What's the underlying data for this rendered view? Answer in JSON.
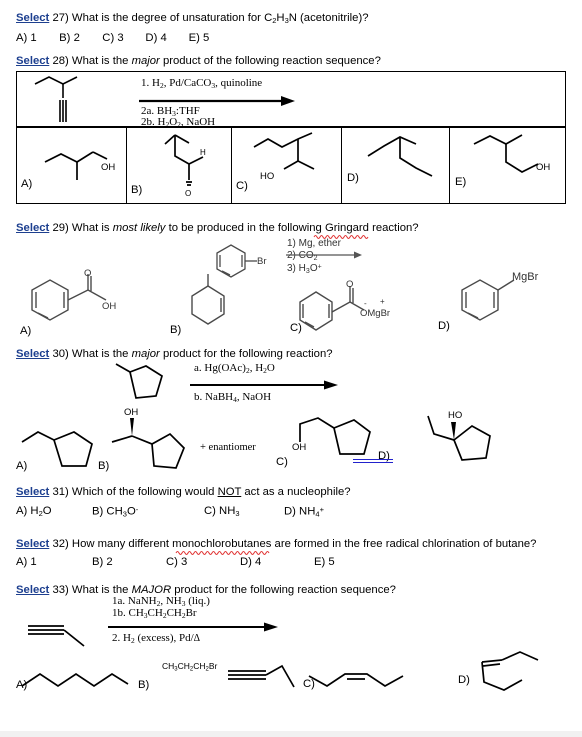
{
  "page": {
    "background": "#ffffff",
    "link_color": "#1d3f8f",
    "spellcheck_underline_color": "#e03030"
  },
  "questions": [
    {
      "id": "q27",
      "select_label": "Select",
      "number": "27)",
      "stem_pre": "What is the degree of unsaturation for C",
      "stem_formula": "C2H3N",
      "stem_post": " (acetonitrile)?",
      "options": [
        "A) 1",
        "B) 2",
        "C) 3",
        "D) 4",
        "E) 5"
      ]
    },
    {
      "id": "q28",
      "select_label": "Select",
      "number": "28)",
      "stem": "What is the major product of the following reaction sequence?",
      "emphasis": "major",
      "reaction": {
        "above_line": "1. H2, Pd/CaCO3, quinoline",
        "below_line_a": "2a. BH3:THF",
        "below_line_b": "2b. H2O2, NaOH",
        "starting_material": "3-methyl-1-pentyne (terminal alkyne, branched)"
      },
      "options": [
        {
          "label": "A)",
          "structure": "3-methyl-3-pentanol (tertiary alcohol with OH)"
        },
        {
          "label": "B)",
          "structure": "3-methylbutanal (aldehyde, CHO)"
        },
        {
          "label": "C)",
          "structure": "3-methyl-2-pentanol (HO on C2)"
        },
        {
          "label": "D)",
          "structure": "3-methylpentane (no oxygen)"
        },
        {
          "label": "E)",
          "structure": "3-methyl-1-pentanol (primary alcohol OH)"
        }
      ]
    },
    {
      "id": "q29",
      "select_label": "Select",
      "number": "29)",
      "stem": "What is most likely to be produced in the following Gringard reaction?",
      "emphasis": "most likely",
      "misspelled_word": "Gringard",
      "reaction": {
        "substrate": "bromobenzene",
        "substrate_label": "Br",
        "steps": [
          "1) Mg, ether",
          "2) CO2",
          "3) H3O+"
        ]
      },
      "options": [
        {
          "label": "A)",
          "structure": "benzoic acid (C=O with OH)",
          "atoms": [
            "O",
            "OH"
          ]
        },
        {
          "label": "B)",
          "structure": "3-methylcyclohexene"
        },
        {
          "label": "C)",
          "structure": "benzoate magnesium bromide salt",
          "atoms": [
            "O",
            "-",
            "+",
            "OMgBr"
          ]
        },
        {
          "label": "D)",
          "structure": "phenylmagnesium bromide",
          "atoms": [
            "MgBr"
          ]
        }
      ]
    },
    {
      "id": "q30",
      "select_label": "Select",
      "number": "30)",
      "stem": "What is the major product for the following reaction?",
      "emphasis": "major",
      "reaction": {
        "substrate": "vinylcyclopentane",
        "above_line": "a. Hg(OAc)2, H2O",
        "below_line": "b. NaBH4, NaOH"
      },
      "options": [
        {
          "label": "A)",
          "structure": "ethylcyclopentane"
        },
        {
          "label": "B)",
          "structure": "1-cyclopentylethanol with wedge OH",
          "atoms": [
            "OH"
          ],
          "note": "+  enantiomer"
        },
        {
          "label": "C)",
          "structure": "2-cyclopentylethanol",
          "atoms": [
            "OH"
          ]
        },
        {
          "label": "D)",
          "structure": "1-ethylcyclopentanol",
          "atoms": [
            "HO"
          ],
          "underlined": true
        }
      ]
    },
    {
      "id": "q31",
      "select_label": "Select",
      "number": "31)",
      "stem_pre": "Which of the following would ",
      "stem_not": "NOT",
      "stem_post": " act as a nucleophile?",
      "options": [
        "A) H2O",
        "B) CH3O−",
        "C) NH3",
        "D) NH4+"
      ]
    },
    {
      "id": "q32",
      "select_label": "Select",
      "number": "32)",
      "stem_pre": "How many different ",
      "stem_misspelled": "monochlorobutanes",
      "stem_post": " are formed in the free radical chlorination of butane?",
      "options": [
        "A) 1",
        "B) 2",
        "C) 3",
        "D) 4",
        "E) 5"
      ]
    },
    {
      "id": "q33",
      "select_label": "Select",
      "number": "33)",
      "stem": "What is the MAJOR product for the following reaction sequence?",
      "emphasis": "MAJOR",
      "reaction": {
        "substrate": "1-butyne (terminal alkyne)",
        "above_line_a": "1a. NaNH2, NH3 (liq.)",
        "above_line_b": "1b. CH3CH2CH2Br",
        "below_line": "2. H2 (excess), Pd/ Δ"
      },
      "options": [
        {
          "label": "A)",
          "structure": "heptane (straight chain saturated)"
        },
        {
          "label": "B)",
          "structure": "CH3CH2CH2Br attached to alkyne",
          "formula": "CH3CH2CH2Br"
        },
        {
          "label": "C)",
          "structure": "trans-alkene chain"
        },
        {
          "label": "D)",
          "structure": "cis-alkene chain (Z)"
        }
      ]
    }
  ]
}
